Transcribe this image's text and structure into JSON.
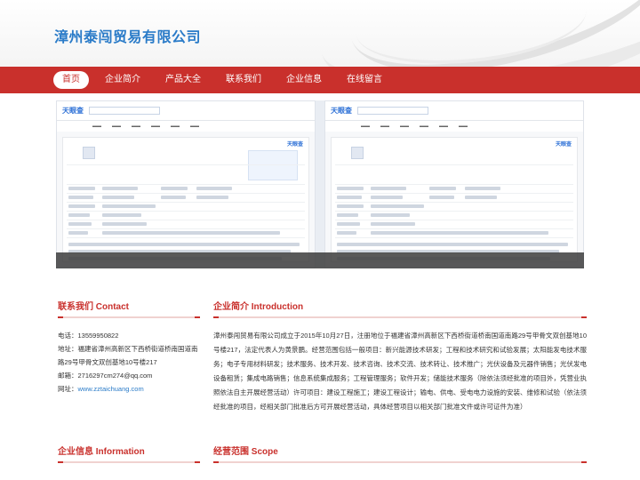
{
  "site": {
    "title": "漳州泰闯贸易有限公司"
  },
  "nav": {
    "items": [
      {
        "label": "首页",
        "active": true
      },
      {
        "label": "企业简介",
        "active": false
      },
      {
        "label": "产品大全",
        "active": false
      },
      {
        "label": "联系我们",
        "active": false
      },
      {
        "label": "企业信息",
        "active": false
      },
      {
        "label": "在线留言",
        "active": false
      }
    ]
  },
  "banner": {
    "left_logo": "天眼查",
    "right_logo": "天眼查",
    "left_badge": "天眼查",
    "right_badge": "天眼查"
  },
  "contact": {
    "heading": "联系我们",
    "heading_en": "Contact",
    "phone": "电话：13559950822",
    "address": "地址：福建省漳州高新区下西桥街道桥南国道南路29号甲骨文双创基地10号楼217",
    "email": "邮箱：2716297cm274@qq.com",
    "website_label": "网址：",
    "website": "www.zztaichuang.com"
  },
  "intro": {
    "heading": "企业简介",
    "heading_en": "Introduction",
    "text": "漳州泰闯贸易有限公司成立于2015年10月27日，注册地位于福建省漳州高新区下西桥街道桥南国道南路29号甲骨文双创基地10号楼217，法定代表人为黄景鹏。经营范围包括一般项目：新兴能源技术研发；工程和技术研究和试验发展；太阳能发电技术服务；电子专用材料研发；技术服务、技术开发、技术咨询、技术交流、技术转让、技术推广；光伏设备及元器件销售；光伏发电设备租赁；集成电路销售；信息系统集成服务；工程管理服务；软件开发；储能技术服务（除依法须经批准的项目外，凭营业执照依法自主开展经营活动）许可项目：建设工程施工；建设工程设计；输电、供电、受电电力设施的安装、维修和试验（依法须经批准的项目，经相关部门批准后方可开展经营活动，具体经营项目以相关部门批准文件或许可证件为准）"
  },
  "info": {
    "heading": "企业信息",
    "heading_en": "Information"
  },
  "scope": {
    "heading": "经营范围",
    "heading_en": "Scope"
  },
  "colors": {
    "brand_red": "#c9302c",
    "title_blue": "#2a7bc8"
  }
}
